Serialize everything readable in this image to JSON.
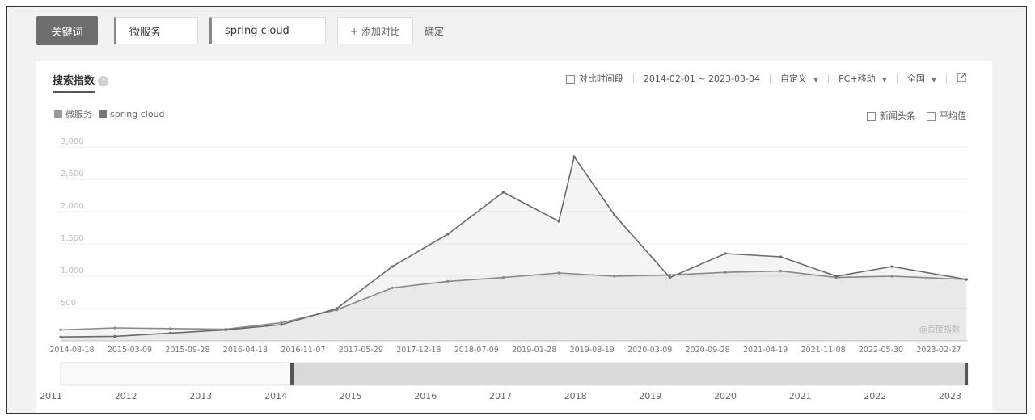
{
  "toolbar": {
    "keyword_button": "关键词",
    "keyword1": "微服务",
    "keyword2": "spring cloud",
    "add_compare": "+ 添加对比",
    "confirm": "确定"
  },
  "panel": {
    "title": "搜索指数",
    "help_glyph": "?",
    "compare_period": "对比时间段",
    "date_range": "2014-02-01 ~ 2023-03-04",
    "custom": "自定义",
    "device": "PC+移动",
    "region": "全国",
    "news": "新闻头条",
    "average": "平均值",
    "watermark": "@百度指数",
    "export_icon": "external-link-icon"
  },
  "colors": {
    "series1": "#999999",
    "series2": "#7a7a7a"
  },
  "chart_data": {
    "type": "line",
    "x_ticks": [
      "2014-08-18",
      "2015-03-09",
      "2015-09-28",
      "2016-04-18",
      "2016-11-07",
      "2017-05-29",
      "2017-12-18",
      "2018-07-09",
      "2019-01-28",
      "2019-08-19",
      "2020-03-09",
      "2020-09-28",
      "2021-04-19",
      "2021-11-08",
      "2022-05-30",
      "2023-02-27"
    ],
    "y_ticks": [
      "3,000",
      "2,500",
      "2,000",
      "1,500",
      "1,000",
      "500"
    ],
    "ylim": [
      0,
      3000
    ],
    "xlim": [
      "2014-02-01",
      "2023-03-04"
    ],
    "series": [
      {
        "name": "微服务",
        "color": "#8a8a8a",
        "points": [
          [
            "2014-02-01",
            170
          ],
          [
            "2014-08-18",
            200
          ],
          [
            "2015-03-09",
            190
          ],
          [
            "2015-09-28",
            180
          ],
          [
            "2016-04-18",
            280
          ],
          [
            "2016-11-07",
            480
          ],
          [
            "2017-05-29",
            820
          ],
          [
            "2017-12-18",
            920
          ],
          [
            "2018-07-09",
            980
          ],
          [
            "2019-01-28",
            1050
          ],
          [
            "2019-08-19",
            1000
          ],
          [
            "2020-03-09",
            1020
          ],
          [
            "2020-09-28",
            1060
          ],
          [
            "2021-04-19",
            1080
          ],
          [
            "2021-11-08",
            980
          ],
          [
            "2022-05-30",
            1000
          ],
          [
            "2023-02-27",
            950
          ]
        ]
      },
      {
        "name": "spring cloud",
        "color": "#6a6a6a",
        "points": [
          [
            "2014-02-01",
            60
          ],
          [
            "2014-08-18",
            70
          ],
          [
            "2015-03-09",
            120
          ],
          [
            "2015-09-28",
            170
          ],
          [
            "2016-04-18",
            250
          ],
          [
            "2016-11-07",
            500
          ],
          [
            "2017-05-29",
            1150
          ],
          [
            "2017-12-18",
            1650
          ],
          [
            "2018-07-09",
            2300
          ],
          [
            "2019-01-28",
            1850
          ],
          [
            "2019-03-25",
            2850
          ],
          [
            "2019-08-19",
            1950
          ],
          [
            "2020-03-09",
            980
          ],
          [
            "2020-09-28",
            1350
          ],
          [
            "2021-04-19",
            1300
          ],
          [
            "2021-11-08",
            1000
          ],
          [
            "2022-05-30",
            1150
          ],
          [
            "2023-02-27",
            950
          ]
        ]
      }
    ]
  },
  "navigator": {
    "years": [
      "2011",
      "2012",
      "2013",
      "2014",
      "2015",
      "2016",
      "2017",
      "2018",
      "2019",
      "2020",
      "2021",
      "2022",
      "2023"
    ]
  }
}
